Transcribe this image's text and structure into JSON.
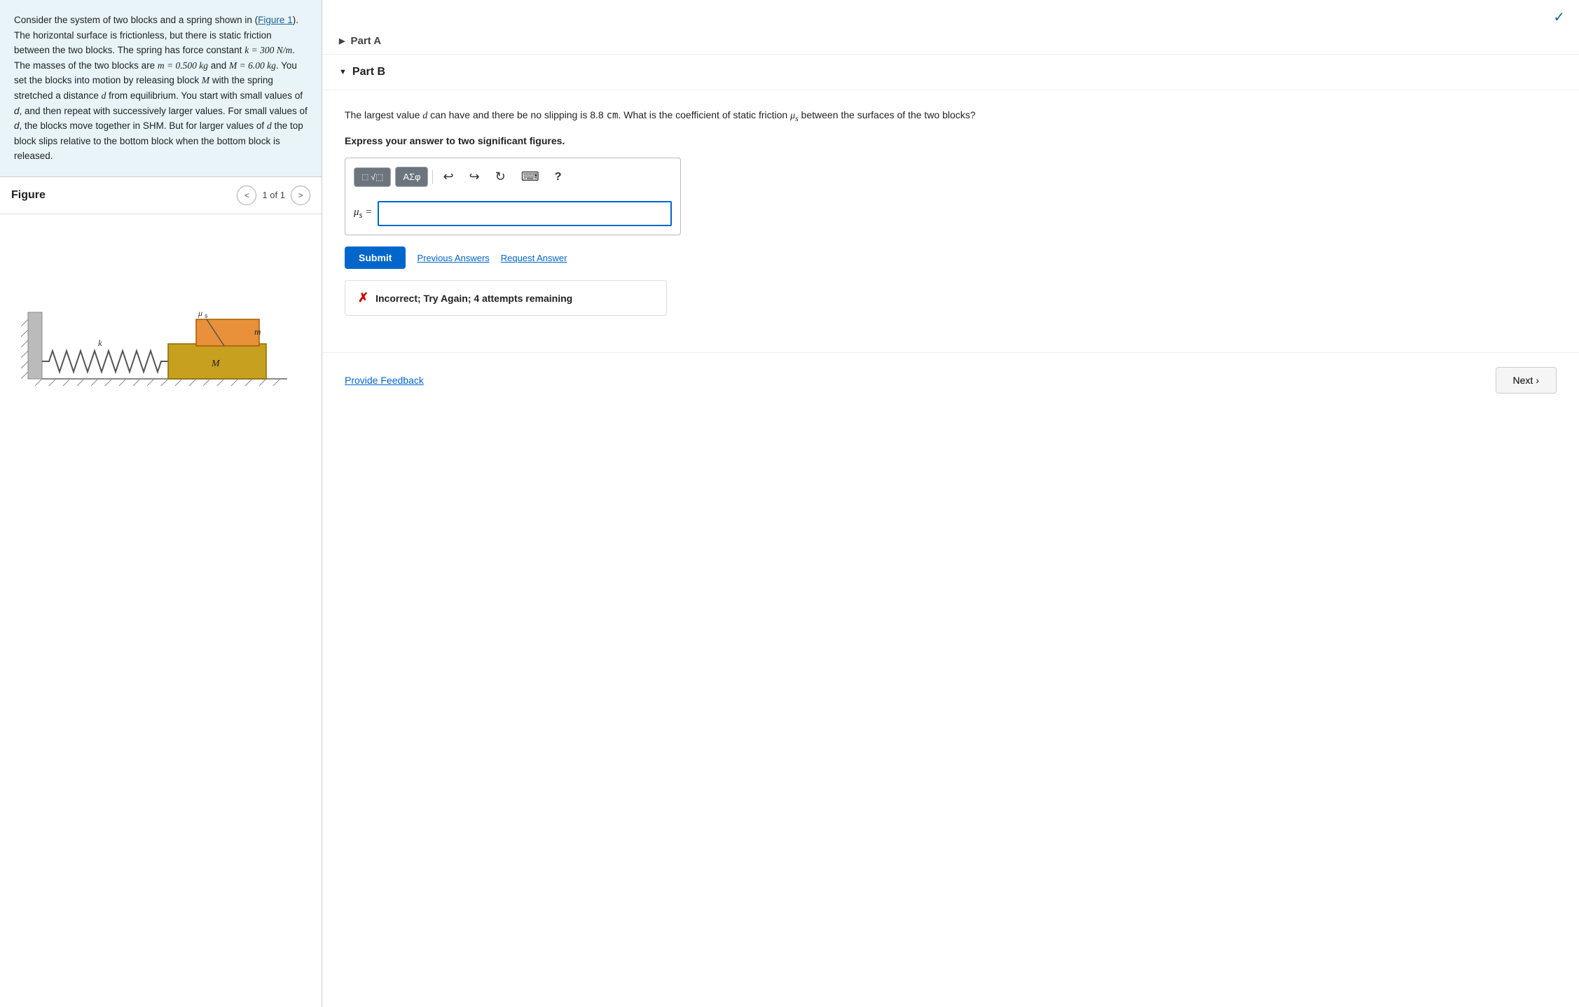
{
  "leftPanel": {
    "problemText": {
      "intro": "Consider the system of two blocks and a spring shown in (Figure 1). The horizontal surface is frictionless, but there is static friction between the two blocks. The spring has force constant ",
      "k_val": "k = 300 N/m",
      "mid1": ". The masses of the two blocks are ",
      "m_val": "m = 0.500 kg",
      "and": " and ",
      "M_val": "M = 6.00 kg",
      "rest": ". You set the blocks into motion by releasing block M with the spring stretched a distance d from equilibrium. You start with small values of d, and then repeat with successively larger values. For small values of d, the blocks move together in SHM. But for larger values of d the top block slips relative to the bottom block when the bottom block is released.",
      "figureLink": "Figure 1"
    },
    "figure": {
      "title": "Figure",
      "counter": "1 of 1",
      "prevLabel": "<",
      "nextLabel": ">"
    }
  },
  "rightPanel": {
    "checkmark": "✓",
    "partA": {
      "label": "Part A",
      "collapsed": true
    },
    "partB": {
      "label": "Part B",
      "questionText": "The largest value d can have and there be no slipping is 8.8 cm. What is the coefficient of static friction μ",
      "questionSuffix": " between the surfaces of the two blocks?",
      "subscript": "s",
      "expressLabel": "Express your answer to two significant figures.",
      "toolbar": {
        "formulaBtn": "⬚√⬚",
        "greekBtn": "ΑΣφ",
        "undoIcon": "↩",
        "redoIcon": "↪",
        "refreshIcon": "↻",
        "keyboardIcon": "⌨",
        "helpIcon": "?"
      },
      "inputLabel": "μs =",
      "inputPlaceholder": "",
      "submitLabel": "Submit",
      "previousAnswersLabel": "Previous Answers",
      "requestAnswerLabel": "Request Answer",
      "incorrectMessage": "Incorrect; Try Again; 4 attempts remaining"
    },
    "footer": {
      "provideFeedbackLabel": "Provide Feedback",
      "nextLabel": "Next",
      "nextArrow": "›"
    }
  }
}
